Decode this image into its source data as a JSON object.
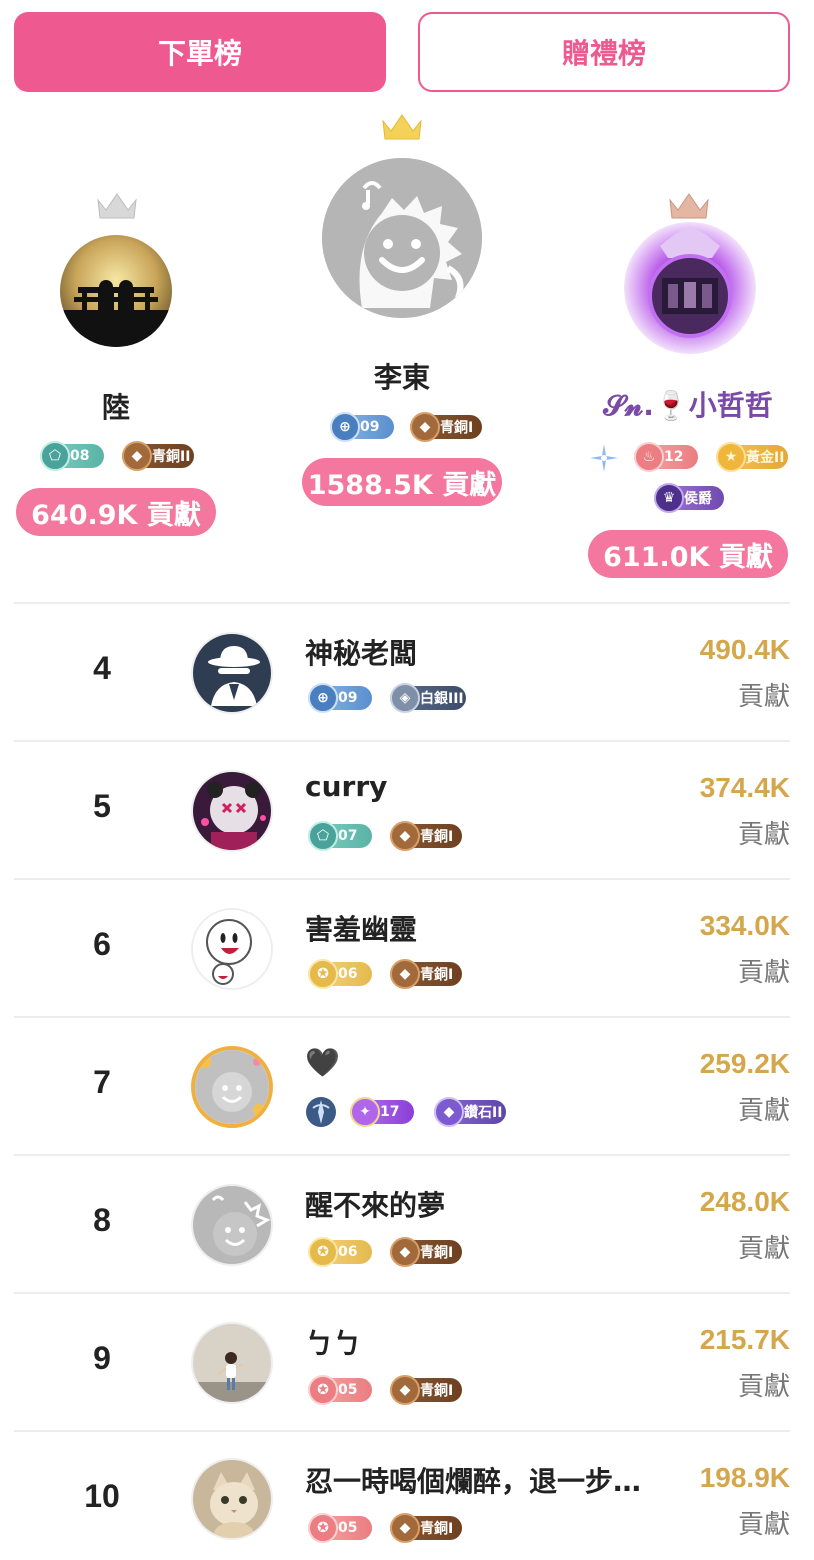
{
  "tabs": {
    "order_board": "下單榜",
    "gift_board": "贈禮榜"
  },
  "podium": {
    "first": {
      "name": "李東",
      "level": "09",
      "rank_badge": "青銅I",
      "contribution": "1588.5K 貢獻"
    },
    "second": {
      "name": "陸",
      "level": "08",
      "rank_badge": "青銅II",
      "contribution": "640.9K 貢獻"
    },
    "third": {
      "name": "𝓢𝓷.🍷小哲哲",
      "level": "12",
      "rank_badge": "黃金II",
      "noble_badge": "侯爵",
      "contribution": "611.0K 貢獻"
    }
  },
  "list": [
    {
      "rank": "4",
      "name": "神秘老闆",
      "level": "09",
      "rank_badge": "白銀III",
      "score": "490.4K",
      "unit": "貢獻"
    },
    {
      "rank": "5",
      "name": "curry",
      "level": "07",
      "rank_badge": "青銅I",
      "score": "374.4K",
      "unit": "貢獻"
    },
    {
      "rank": "6",
      "name": "害羞幽靈",
      "level": "06",
      "rank_badge": "青銅I",
      "score": "334.0K",
      "unit": "貢獻"
    },
    {
      "rank": "7",
      "name": "🖤",
      "level": "17",
      "rank_badge": "鑽石II",
      "score": "259.2K",
      "unit": "貢獻"
    },
    {
      "rank": "8",
      "name": "醒不來的夢",
      "level": "06",
      "rank_badge": "青銅I",
      "score": "248.0K",
      "unit": "貢獻"
    },
    {
      "rank": "9",
      "name": "ㄅㄅ",
      "level": "05",
      "rank_badge": "青銅I",
      "score": "215.7K",
      "unit": "貢獻"
    },
    {
      "rank": "10",
      "name": "忍一時喝個爛醉，退一步…",
      "level": "05",
      "rank_badge": "青銅I",
      "score": "198.9K",
      "unit": "貢獻"
    }
  ],
  "colors": {
    "accent_pink": "#ee5a8f",
    "score_gold": "#d4a74c"
  }
}
